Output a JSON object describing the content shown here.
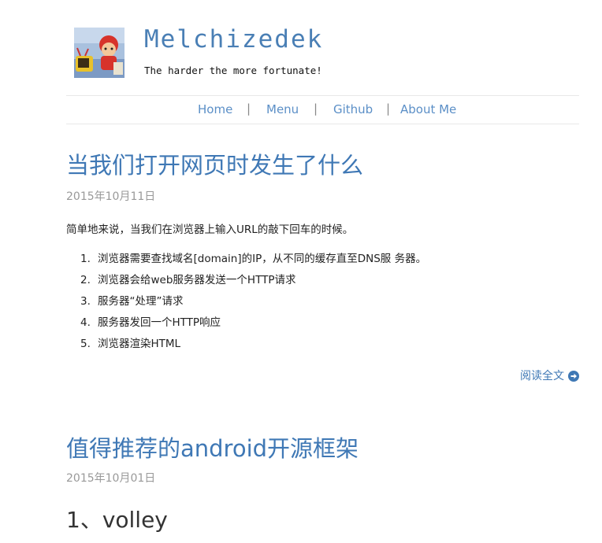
{
  "header": {
    "site_title": "Melchizedek",
    "tagline": "The harder the more fortunate!",
    "avatar_alt": "avatar"
  },
  "nav": {
    "items": [
      {
        "label": "Home"
      },
      {
        "label": "Menu"
      },
      {
        "label": "Github"
      },
      {
        "label": "About Me"
      }
    ],
    "separator": "|"
  },
  "posts": [
    {
      "title": "当我们打开网页时发生了什么",
      "date": "2015年10月11日",
      "intro": "简单地来说，当我们在浏览器上输入URL的敲下回车的时候。",
      "list": [
        {
          "num": "1.",
          "text": "浏览器需要查找域名[domain]的IP，从不同的缓存直至DNS服 务器。"
        },
        {
          "num": "2.",
          "text": "浏览器会给web服务器发送一个HTTP请求"
        },
        {
          "num": "3.",
          "text": "服务器“处理”请求"
        },
        {
          "num": "4.",
          "text": "服务器发回一个HTTP响应"
        },
        {
          "num": "5.",
          "text": "浏览器渲染HTML"
        }
      ],
      "read_more": "阅读全文"
    },
    {
      "title": "值得推荐的android开源框架",
      "date": "2015年10月01日",
      "section_heading": "1、volley"
    }
  ],
  "colors": {
    "link": "#3f78b5",
    "nav_link": "#5b8fc7",
    "date": "#999999"
  }
}
